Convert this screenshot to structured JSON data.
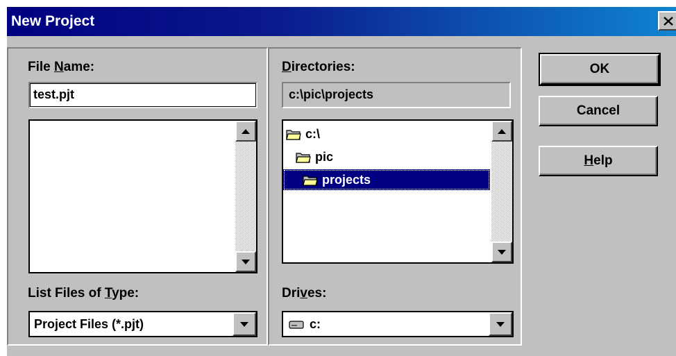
{
  "window": {
    "title": "New Project"
  },
  "file_name": {
    "label_pre": "File ",
    "label_key": "N",
    "label_post": "ame:",
    "value": "test.pjt",
    "files": []
  },
  "directories": {
    "label_key": "D",
    "label_post": "irectories:",
    "current_path": "c:\\pic\\projects",
    "items": [
      {
        "name": "c:\\",
        "selected": false
      },
      {
        "name": "pic",
        "selected": false
      },
      {
        "name": "projects",
        "selected": true
      }
    ]
  },
  "file_type": {
    "label_pre": "List Files of ",
    "label_key": "T",
    "label_post": "ype:",
    "selected": "Project Files (*.pjt)"
  },
  "drives": {
    "label_pre": "Dri",
    "label_key": "v",
    "label_post": "es:",
    "selected": "c:"
  },
  "buttons": {
    "ok": "OK",
    "cancel": "Cancel",
    "help_key": "H",
    "help_post": "elp"
  },
  "colors": {
    "title_start": "#000080",
    "title_end": "#1084d0",
    "face": "#c0c0c0",
    "selection": "#000080"
  }
}
